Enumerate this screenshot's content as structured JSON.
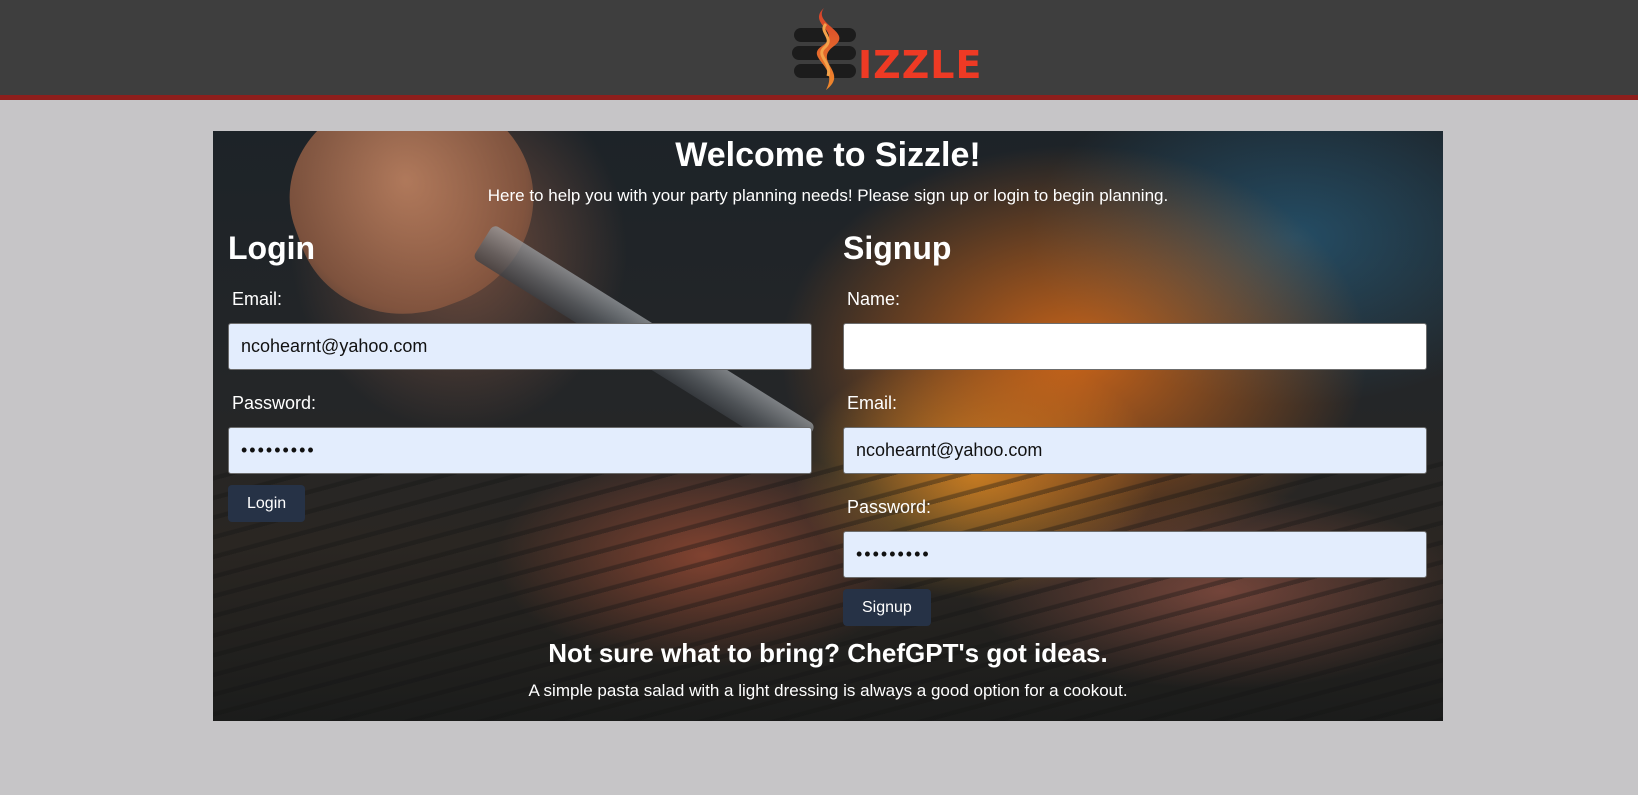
{
  "header": {
    "logo_text": "IZZLE",
    "logo_icon": "flame-s-icon",
    "colors": {
      "background": "#3e3e3e",
      "border": "#8e1e1c",
      "brand": "#ee3a24"
    }
  },
  "welcome": {
    "title": "Welcome to Sizzle!",
    "subtitle": "Here to help you with your party planning needs! Please sign up or login to begin planning."
  },
  "login": {
    "title": "Login",
    "email_label": "Email:",
    "email_value": "ncohearnt@yahoo.com",
    "password_label": "Password:",
    "password_value": "•••••••••",
    "button_label": "Login"
  },
  "signup": {
    "title": "Signup",
    "name_label": "Name:",
    "name_value": "",
    "email_label": "Email:",
    "email_value": "ncohearnt@yahoo.com",
    "password_label": "Password:",
    "password_value": "•••••••••",
    "button_label": "Signup"
  },
  "idea": {
    "title": "Not sure what to bring? ChefGPT's got ideas.",
    "text": "A simple pasta salad with a light dressing is always a good option for a cookout."
  },
  "colors": {
    "button": "#263246",
    "autofill": "#e3edfd",
    "page_background": "#c6c5c7"
  }
}
